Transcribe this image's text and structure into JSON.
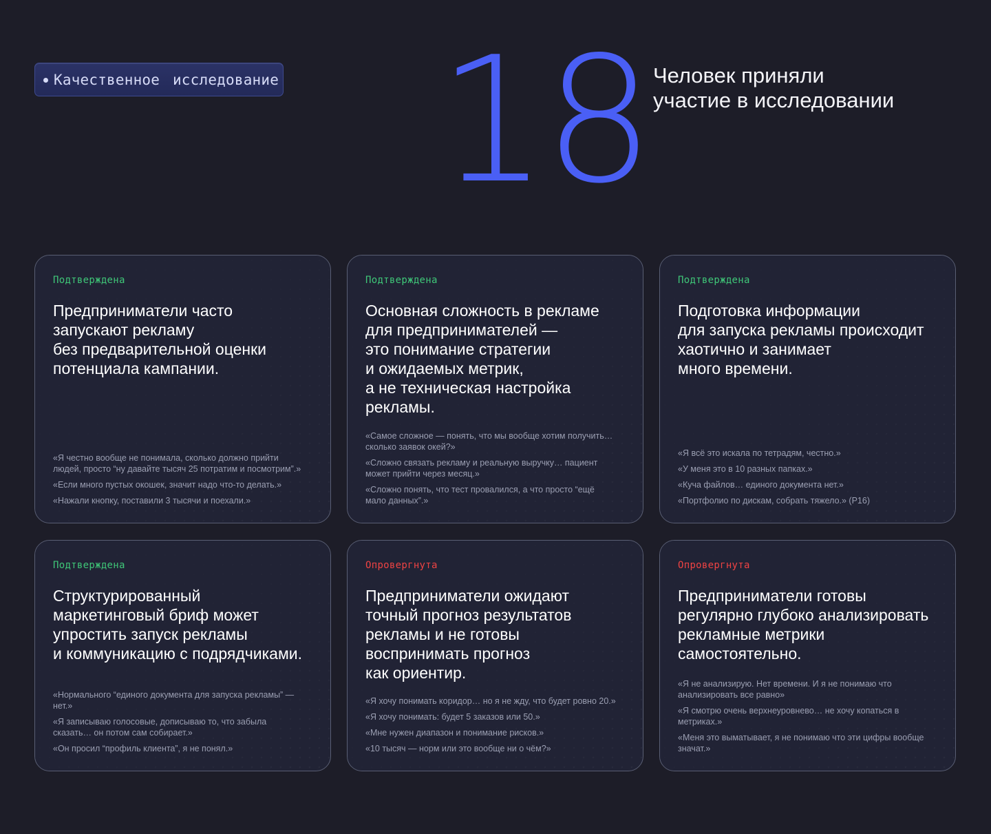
{
  "header": {
    "tag_label": "Качественное исследование",
    "participants_count": "18",
    "participants_line1": "Человек приняли",
    "participants_line2": "участие в исследовании"
  },
  "colors": {
    "background": "#1d1d28",
    "accent_blue": "#4a5ff5",
    "confirmed": "#3fc778",
    "refuted": "#ef4343"
  },
  "cards": [
    {
      "status": "Подтверждена",
      "status_type": "confirmed",
      "lines": [
        "Предприниматели часто",
        "запускают рекламу",
        "без предварительной оценки",
        "потенциала кампании."
      ],
      "quotes": [
        [
          "«Я честно вообще не понимала, сколько должно прийти",
          "людей, просто “ну давайте тысяч 25 потратим и посмотрим”.»"
        ],
        [
          "«Если много пустых окошек, значит надо что-то делать.»"
        ],
        [
          "«Нажали кнопку, поставили 3 тысячи и поехали.»"
        ]
      ]
    },
    {
      "status": "Подтверждена",
      "status_type": "confirmed",
      "lines": [
        "Основная сложность в рекламе",
        "для предпринимателей —",
        "это понимание стратегии",
        "и ожидаемых метрик,",
        "а не техническая настройка",
        "рекламы."
      ],
      "quotes": [
        [
          "«Самое сложное — понять, что мы вообще хотим получить…",
          "сколько заявок окей?»"
        ],
        [
          "«Сложно связать рекламу и реальную выручку… пациент",
          "может прийти через месяц.»"
        ],
        [
          "«Сложно понять, что тест провалился, а что просто “ещё",
          "мало данных”.»"
        ]
      ]
    },
    {
      "status": "Подтверждена",
      "status_type": "confirmed",
      "lines": [
        "Подготовка информации",
        "для запуска рекламы происходит",
        "хаотично и занимает",
        "много времени."
      ],
      "quotes": [
        [
          "«Я всё это искала по тетрадям, честно.»"
        ],
        [
          "«У меня это в 10 разных папках.»"
        ],
        [
          "«Куча файлов… единого документа нет.»"
        ],
        [
          "«Портфолио по дискам, собрать тяжело.» (P16)"
        ]
      ]
    },
    {
      "status": "Подтверждена",
      "status_type": "confirmed",
      "lines": [
        "Структурированный",
        "маркетинговый бриф может",
        "упростить запуск рекламы",
        "и коммуникацию с подрядчиками."
      ],
      "quotes": [
        [
          "«Нормального “единого документа для запуска рекламы” —",
          "нет.»"
        ],
        [
          "«Я записываю голосовые, дописываю то, что забыла",
          "сказать… он потом сам собирает.»"
        ],
        [
          "«Он просил “профиль клиента”, я не понял.»"
        ]
      ]
    },
    {
      "status": "Опровергнута",
      "status_type": "refuted",
      "lines": [
        "Предприниматели ожидают",
        "точный прогноз результатов",
        "рекламы и не готовы",
        "воспринимать прогноз",
        "как ориентир."
      ],
      "quotes": [
        [
          "«Я хочу понимать коридор… но я не жду, что будет ровно 20.»"
        ],
        [
          "«Я хочу понимать: будет 5 заказов или 50.»"
        ],
        [
          "«Мне нужен диапазон и понимание рисков.»"
        ],
        [
          "«10 тысяч — норм или это вообще ни о чём?»"
        ]
      ]
    },
    {
      "status": "Опровергнута",
      "status_type": "refuted",
      "lines": [
        "Предприниматели готовы",
        "регулярно глубоко анализировать",
        "рекламные метрики",
        "самостоятельно."
      ],
      "quotes": [
        [
          "«Я не анализирую. Нет времени. И я не понимаю что",
          "анализировать все равно»"
        ],
        [
          "«Я смотрю очень верхнеуровнево… не хочу копаться в",
          "метриках.»"
        ],
        [
          "«Меня это выматывает, я не понимаю что эти цифры вообще",
          "значат.»"
        ]
      ]
    }
  ]
}
